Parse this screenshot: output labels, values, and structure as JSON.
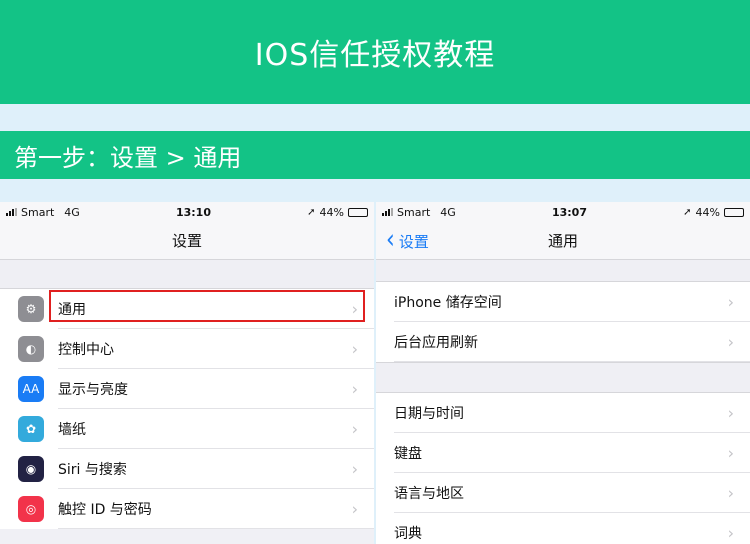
{
  "banner": {
    "title": "IOS信任授权教程"
  },
  "step": {
    "text": "第一步：设置 > 通用"
  },
  "left_phone": {
    "status": {
      "carrier": "Smart",
      "network": "4G",
      "time": "13:10",
      "battery": "44%",
      "battery_level": 0.44
    },
    "nav_title": "设置",
    "items": [
      {
        "label": "通用",
        "icon": "gear-icon",
        "color": "#8e8e93",
        "glyph": "⚙"
      },
      {
        "label": "控制中心",
        "icon": "toggle-icon",
        "color": "#8e8e93",
        "glyph": "◐"
      },
      {
        "label": "显示与亮度",
        "icon": "text-size-icon",
        "color": "#1a7cf5",
        "glyph": "AA"
      },
      {
        "label": "墙纸",
        "icon": "flower-icon",
        "color": "#33aadc",
        "glyph": "✿"
      },
      {
        "label": "Siri 与搜索",
        "icon": "siri-icon",
        "color": "#222244",
        "glyph": "◉"
      },
      {
        "label": "触控 ID 与密码",
        "icon": "fingerprint-icon",
        "color": "#f2334a",
        "glyph": "◎"
      }
    ],
    "highlighted": "通用"
  },
  "right_phone": {
    "status": {
      "carrier": "Smart",
      "network": "4G",
      "time": "13:07",
      "battery": "44%",
      "battery_level": 0.44
    },
    "back_label": "设置",
    "nav_title": "通用",
    "group1": [
      {
        "label": "iPhone 储存空间"
      },
      {
        "label": "后台应用刷新"
      }
    ],
    "group2": [
      {
        "label": "日期与时间"
      },
      {
        "label": "键盘"
      },
      {
        "label": "语言与地区"
      },
      {
        "label": "词典"
      }
    ]
  },
  "colors": {
    "brand_green": "#13c386",
    "highlight_red": "#e02020",
    "ios_blue": "#1a7cf5"
  }
}
